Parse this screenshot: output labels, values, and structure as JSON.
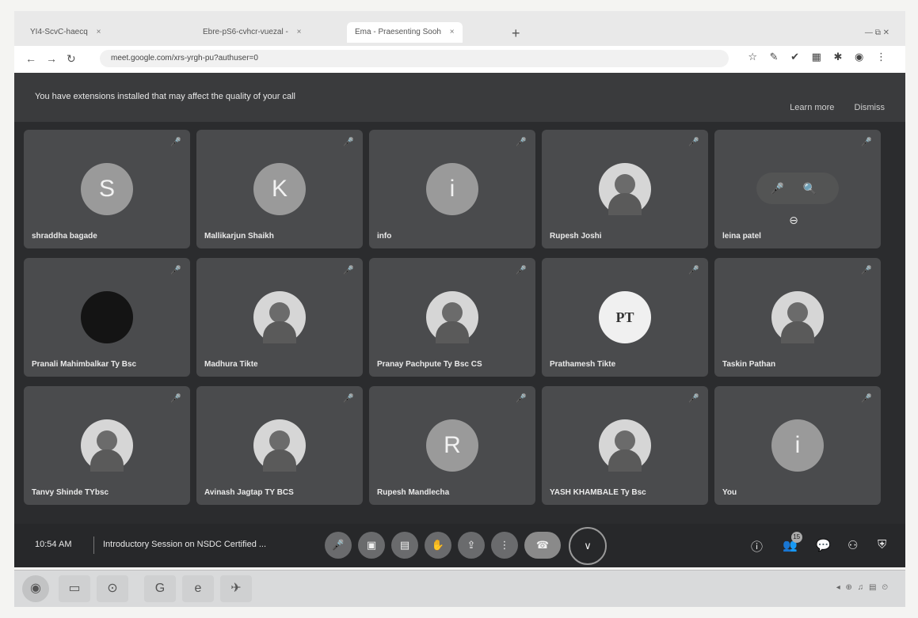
{
  "browser": {
    "tabs": [
      {
        "label": "YI4-ScvC-haecq",
        "close": "×"
      },
      {
        "label": "Ebre-pS6-cvhcr-vuezal -",
        "close": "×"
      },
      {
        "label": "Ema - Praesenting Sooh",
        "close": "×"
      }
    ],
    "new_tab": "+",
    "url": "meet.google.com/xrs-yrgh-pu?authuser=0",
    "window_controls": "— ⧉ ✕",
    "extension_icons": "☆ ✎ ✔ ▦ ✱ ◉ ⋮"
  },
  "banner": {
    "text": "You have extensions installed that may affect the quality of your call",
    "learn_more": "Learn more",
    "dismiss": "Dismiss"
  },
  "participants": [
    {
      "name": "shraddha bagade",
      "initial": "S",
      "avatar": "initial"
    },
    {
      "name": "Mallikarjun Shaikh",
      "initial": "K",
      "avatar": "initial"
    },
    {
      "name": "info",
      "initial": "i",
      "avatar": "initial"
    },
    {
      "name": "Rupesh Joshi",
      "initial": "",
      "avatar": "photo"
    },
    {
      "name": "leina patel",
      "initial": "",
      "avatar": "pinned"
    },
    {
      "name": "Pranali Mahimbalkar Ty Bsc",
      "initial": "",
      "avatar": "dark"
    },
    {
      "name": "Madhura Tikte",
      "initial": "",
      "avatar": "photo"
    },
    {
      "name": "Pranay Pachpute Ty Bsc CS",
      "initial": "",
      "avatar": "photo"
    },
    {
      "name": "Prathamesh Tikte",
      "initial": "PT",
      "avatar": "logo"
    },
    {
      "name": "Taskin Pathan",
      "initial": "",
      "avatar": "photo"
    },
    {
      "name": "Tanvy Shinde TYbsc",
      "initial": "",
      "avatar": "photo"
    },
    {
      "name": "Avinash Jagtap TY BCS",
      "initial": "",
      "avatar": "photo"
    },
    {
      "name": "Rupesh Mandlecha",
      "initial": "R",
      "avatar": "initial"
    },
    {
      "name": "YASH KHAMBALE Ty Bsc",
      "initial": "",
      "avatar": "photo"
    },
    {
      "name": "You",
      "initial": "i",
      "avatar": "initial"
    }
  ],
  "pinned_controls": "🎤 🔍 ⊖",
  "controls": {
    "time": "10:54 AM",
    "meeting_title": "Introductory Session on NSDC Certified ...",
    "mic": "🎤",
    "camera": "▣",
    "captions": "▤",
    "hand": "✋",
    "present": "⇪",
    "more": "⋮",
    "leave": "☎",
    "extra": "∨",
    "info": "ⓘ",
    "people": "👥",
    "people_count": "15",
    "chat": "💬",
    "activities": "⚇",
    "host": "⛨"
  },
  "taskbar": {
    "items": [
      "◉",
      "▭",
      "⊙",
      "G",
      "e",
      "✈"
    ],
    "tray": "◂ ⊕ ♫ ▤ ⏲"
  }
}
